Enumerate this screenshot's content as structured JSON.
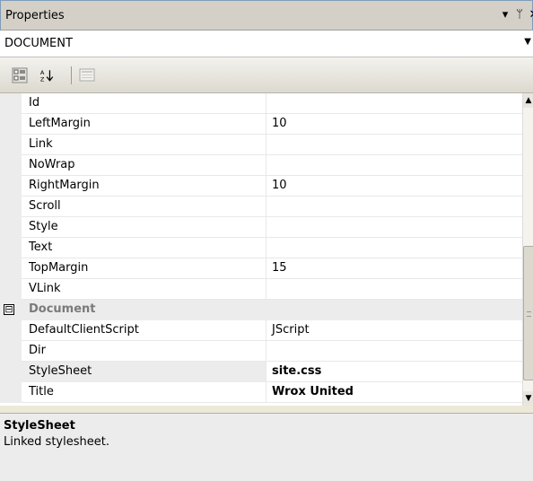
{
  "panel": {
    "title": "Properties"
  },
  "object_selector": {
    "value": "DOCUMENT"
  },
  "toolbar": {
    "categorized_icon": "categorized-icon",
    "alphabetical_icon": "sort-az-icon",
    "property_pages_icon": "property-pages-icon"
  },
  "rows": [
    {
      "name": "Id",
      "value": ""
    },
    {
      "name": "LeftMargin",
      "value": "10"
    },
    {
      "name": "Link",
      "value": ""
    },
    {
      "name": "NoWrap",
      "value": ""
    },
    {
      "name": "RightMargin",
      "value": "10"
    },
    {
      "name": "Scroll",
      "value": ""
    },
    {
      "name": "Style",
      "value": ""
    },
    {
      "name": "Text",
      "value": ""
    },
    {
      "name": "TopMargin",
      "value": "15"
    },
    {
      "name": "VLink",
      "value": ""
    }
  ],
  "category": {
    "name": "Document",
    "toggle": "⊟"
  },
  "category_rows": [
    {
      "name": "DefaultClientScript",
      "value": "JScript"
    },
    {
      "name": "Dir",
      "value": ""
    },
    {
      "name": "StyleSheet",
      "value": "site.css"
    },
    {
      "name": "Title",
      "value": "Wrox United"
    }
  ],
  "description": {
    "title": "StyleSheet",
    "text": "Linked stylesheet."
  }
}
